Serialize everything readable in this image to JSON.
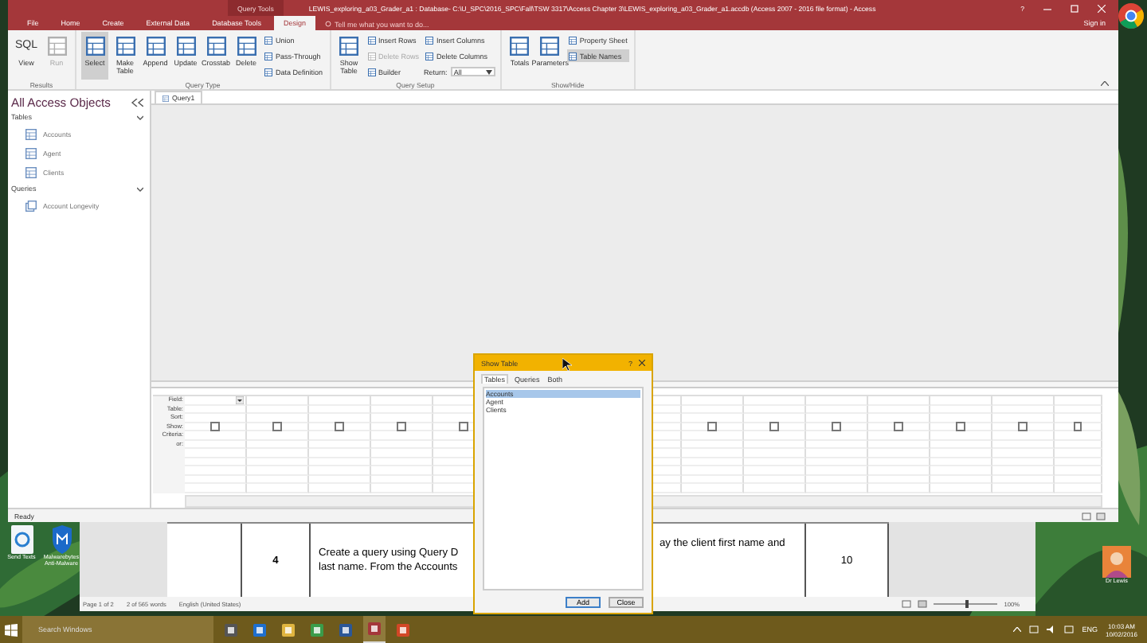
{
  "access": {
    "context_label": "Query Tools",
    "title": "LEWIS_exploring_a03_Grader_a1 : Database- C:\\U_SPC\\2016_SPC\\Fall\\TSW 3317\\Access Chapter 3\\LEWIS_exploring_a03_Grader_a1.accdb (Access 2007 - 2016 file format) - Access",
    "help": "?",
    "tabs": [
      {
        "label": "File",
        "selected": false
      },
      {
        "label": "Home",
        "selected": false
      },
      {
        "label": "Create",
        "selected": false
      },
      {
        "label": "External Data",
        "selected": false
      },
      {
        "label": "Database Tools",
        "selected": false
      },
      {
        "label": "Design",
        "selected": true
      }
    ],
    "tell_me": "Tell me what you want to do...",
    "sign_in": "Sign in",
    "groups": [
      {
        "label": "Results",
        "items": [
          {
            "kind": "large",
            "icon_text": "SQL",
            "label": "View",
            "selected": false,
            "disabled": false
          },
          {
            "kind": "large",
            "label": "Run",
            "selected": false,
            "disabled": true
          }
        ]
      },
      {
        "label": "Query Type",
        "items": [
          {
            "kind": "large",
            "label": "Select",
            "selected": true,
            "disabled": false
          },
          {
            "kind": "large",
            "label": "Make Table",
            "selected": false,
            "disabled": false
          },
          {
            "kind": "large",
            "label": "Append",
            "selected": false,
            "disabled": false
          },
          {
            "kind": "large",
            "label": "Update",
            "selected": false,
            "disabled": false
          },
          {
            "kind": "large",
            "label": "Crosstab",
            "selected": false,
            "disabled": false
          },
          {
            "kind": "large",
            "label": "Delete",
            "selected": false,
            "disabled": false
          },
          {
            "kind": "small",
            "label": "Union",
            "selected": false,
            "disabled": false
          },
          {
            "kind": "small",
            "label": "Pass-Through",
            "selected": false,
            "disabled": false
          },
          {
            "kind": "small",
            "label": "Data Definition",
            "selected": false,
            "disabled": false
          }
        ]
      },
      {
        "label": "Query Setup",
        "items": [
          {
            "kind": "large",
            "label": "Show Table",
            "selected": false,
            "disabled": false
          },
          {
            "kind": "small",
            "label": "Insert Rows",
            "selected": false,
            "disabled": false
          },
          {
            "kind": "small",
            "label": "Delete Rows",
            "selected": false,
            "disabled": true
          },
          {
            "kind": "small",
            "label": "Builder",
            "selected": false,
            "disabled": false
          },
          {
            "kind": "small",
            "label": "Insert Columns",
            "selected": false,
            "disabled": false
          },
          {
            "kind": "small",
            "label": "Delete Columns",
            "selected": false,
            "disabled": false
          },
          {
            "kind": "combo",
            "label": "Return:",
            "value": "All",
            "selected": false,
            "disabled": false
          }
        ]
      },
      {
        "label": "Show/Hide",
        "items": [
          {
            "kind": "large",
            "label": "Totals",
            "selected": false,
            "disabled": false
          },
          {
            "kind": "large",
            "label": "Parameters",
            "selected": false,
            "disabled": false
          },
          {
            "kind": "small",
            "label": "Property Sheet",
            "selected": false,
            "disabled": false
          },
          {
            "kind": "small",
            "label": "Table Names",
            "selected": true,
            "disabled": false
          }
        ]
      }
    ],
    "nav": {
      "title": "All Access Objects",
      "sections": [
        {
          "label": "Tables",
          "kind": "table",
          "items": [
            "Accounts",
            "Agent",
            "Clients"
          ]
        },
        {
          "label": "Queries",
          "kind": "query",
          "items": [
            "Account Longevity"
          ]
        }
      ]
    },
    "doc_tab": "Query1",
    "grid": {
      "row_labels": [
        "Field:",
        "Table:",
        "Sort:",
        "Show:",
        "Criteria:",
        "or:"
      ],
      "columns_left": [
        {
          "show": false
        },
        {
          "show": false
        },
        {
          "show": false
        },
        {
          "show": false
        },
        {
          "show": false
        }
      ],
      "columns_right": [
        {
          "show": false
        },
        {
          "show": false
        },
        {
          "show": false
        },
        {
          "show": false
        },
        {
          "show": false
        },
        {
          "show": false
        },
        {
          "show": false
        }
      ]
    },
    "status": "Ready"
  },
  "dialog": {
    "title": "Show Table",
    "help": "?",
    "tabs": [
      {
        "label": "Tables",
        "selected": true
      },
      {
        "label": "Queries",
        "selected": false
      },
      {
        "label": "Both",
        "selected": false
      }
    ],
    "items": [
      {
        "label": "Accounts",
        "selected": true
      },
      {
        "label": "Agent",
        "selected": false
      },
      {
        "label": "Clients",
        "selected": false
      }
    ],
    "buttons": [
      "Add",
      "Close"
    ]
  },
  "word": {
    "number": "4",
    "text_left": [
      "Create a query using Query D",
      "last name. From the Accounts"
    ],
    "text_right": [
      "ay the client first name and"
    ],
    "points": "10",
    "status": [
      "Page 1 of 2",
      "2 of 565 words",
      "English (United States)"
    ],
    "zoom": "100%",
    "zoom_slider": {
      "level": 0.5
    }
  },
  "desktop": {
    "icons": [
      {
        "label": "Send Texts"
      },
      {
        "label": "Malwarebytes Anti-Malware"
      }
    ],
    "user": "Dr Lewis"
  },
  "taskbar": {
    "placeholder": "Search Windows",
    "language": "ENG",
    "time": "10:03 AM",
    "date": "10/02/2016"
  }
}
